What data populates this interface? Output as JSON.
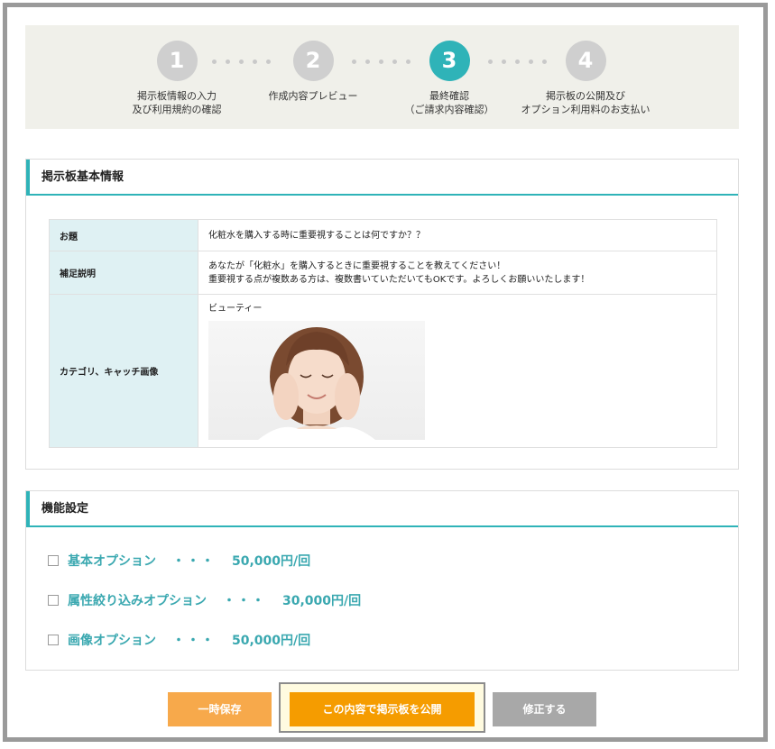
{
  "steps": [
    {
      "num": "1",
      "label": "掲示板情報の入力\n及び利用規約の確認",
      "active": false
    },
    {
      "num": "2",
      "label": "作成内容プレビュー",
      "active": false
    },
    {
      "num": "3",
      "label": "最終確認\n（ご請求内容確認）",
      "active": true
    },
    {
      "num": "4",
      "label": "掲示板の公開及び\nオプション利用料のお支払い",
      "active": false
    }
  ],
  "basic_info": {
    "heading": "掲示板基本情報",
    "rows": [
      {
        "label": "お題",
        "value": "化粧水を購入する時に重要視することは何ですか？？"
      },
      {
        "label": "補足説明",
        "value": "あなたが「化粧水」を購入するときに重要視することを教えてください！\n重要視する点が複数ある方は、複数書いていただいてもOKです。よろしくお願いいたします！"
      },
      {
        "label": "カテゴリ、キャッチ画像",
        "value": "ビューティー"
      }
    ]
  },
  "features": {
    "heading": "機能設定",
    "options": [
      {
        "name": "基本オプション",
        "sep": "・・・",
        "price": "50,000円/回"
      },
      {
        "name": "属性絞り込みオプション",
        "sep": "・・・",
        "price": "30,000円/回"
      },
      {
        "name": "画像オプション",
        "sep": "・・・",
        "price": "50,000円/回"
      }
    ]
  },
  "buttons": {
    "save": "一時保存",
    "publish": "この内容で掲示板を公開",
    "edit": "修正する"
  },
  "colors": {
    "accent": "#2fb3b8",
    "save": "#f7a94b",
    "publish": "#f59c00",
    "edit": "#a8a8a8"
  }
}
